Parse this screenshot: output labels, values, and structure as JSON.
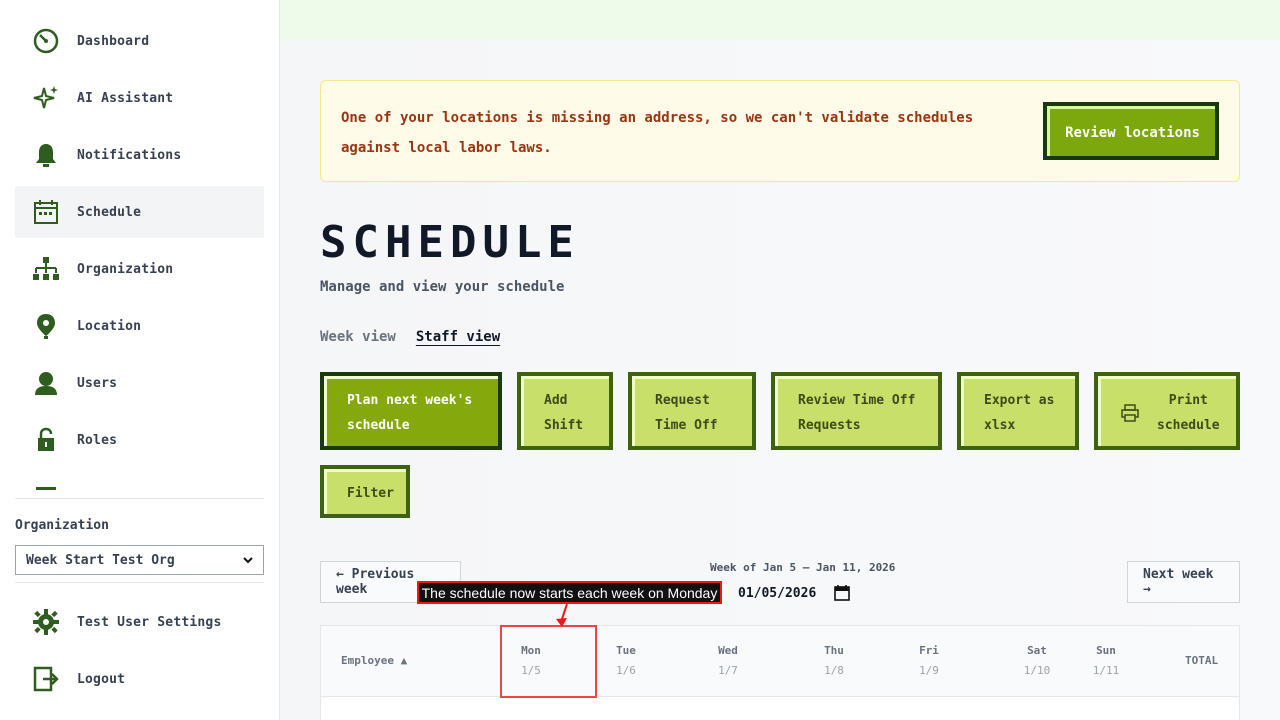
{
  "sidebar": {
    "items": [
      {
        "label": "Dashboard",
        "icon": "dashboard-icon"
      },
      {
        "label": "AI Assistant",
        "icon": "sparkle-icon"
      },
      {
        "label": "Notifications",
        "icon": "bell-icon"
      },
      {
        "label": "Schedule",
        "icon": "calendar-icon",
        "active": true
      },
      {
        "label": "Organization",
        "icon": "org-chart-icon"
      },
      {
        "label": "Location",
        "icon": "location-pin-icon"
      },
      {
        "label": "Users",
        "icon": "user-icon"
      },
      {
        "label": "Roles",
        "icon": "lock-icon"
      }
    ],
    "org_label": "Organization",
    "org_selected": "Week Start Test Org",
    "settings_label": "Test User Settings",
    "logout_label": "Logout"
  },
  "alert": {
    "message": "One of your locations is missing an address, so we can't validate schedules against local labor laws.",
    "button": "Review locations"
  },
  "page": {
    "title": "SCHEDULE",
    "subtitle": "Manage and view your schedule"
  },
  "tabs": {
    "week": "Week view",
    "staff": "Staff view"
  },
  "actions": {
    "plan": "Plan next week's\nschedule",
    "add_shift": "Add\nShift",
    "request_time_off": "Request\nTime Off",
    "review_time_off": "Review Time Off\nRequests",
    "export": "Export as\nxlsx",
    "print": "Print\nschedule",
    "filter": "Filter"
  },
  "week_nav": {
    "prev": "← Previous week",
    "next": "Next week →",
    "label": "Week of Jan 5 – Jan 11, 2026",
    "date_value": "01/05/2026"
  },
  "tooltip": "The schedule now starts each week on Monday",
  "table": {
    "employee_header": "Employee ▲",
    "total_header": "TOTAL",
    "days": [
      {
        "day": "Mon",
        "date": "1/5"
      },
      {
        "day": "Tue",
        "date": "1/6"
      },
      {
        "day": "Wed",
        "date": "1/7"
      },
      {
        "day": "Thu",
        "date": "1/8"
      },
      {
        "day": "Fri",
        "date": "1/9"
      },
      {
        "day": "Sat",
        "date": "1/10"
      },
      {
        "day": "Sun",
        "date": "1/11"
      }
    ]
  },
  "colors": {
    "primary_green": "#85a90c",
    "light_green": "#c8e06a",
    "dark_green": "#1a3a0b",
    "alert_text": "#9a3412",
    "sidebar_icon": "#2f5d1f"
  }
}
